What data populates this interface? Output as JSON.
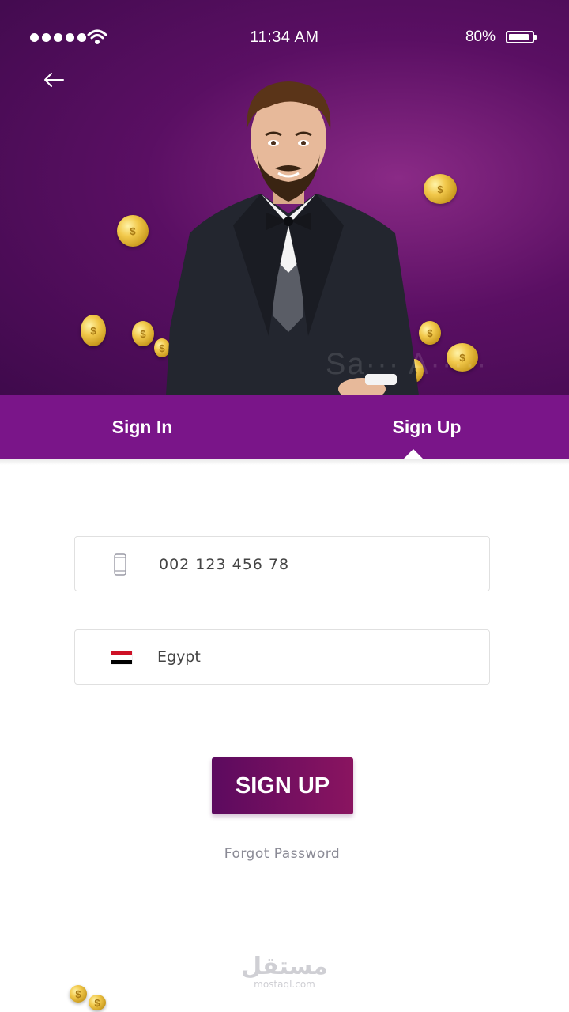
{
  "status_bar": {
    "time": "11:34 AM",
    "battery": "80%",
    "icons": [
      "signal-dots-icon",
      "wifi-icon",
      "battery-icon"
    ]
  },
  "header": {
    "back_icon": "arrow-left-icon",
    "illustration": "man-in-tuxedo-with-coins"
  },
  "tabs": [
    {
      "label": "Sign In",
      "active": false
    },
    {
      "label": "Sign Up",
      "active": true
    }
  ],
  "form": {
    "phone": {
      "icon": "mobile-phone-icon",
      "value": "002 123 456 78"
    },
    "country": {
      "icon": "egypt-flag-icon",
      "value": "Egypt"
    }
  },
  "actions": {
    "signup_label": "SIGN UP",
    "forgot_label": "Forgot Password"
  },
  "footer": {
    "logo_text": "مستقل",
    "logo_url": "mostaql.com"
  },
  "colors": {
    "primary": "#7a1589",
    "hero_dark": "#3f0a4c",
    "button_start": "#5c0a5f",
    "button_end": "#8a1460",
    "coin": "#f2c94c"
  }
}
